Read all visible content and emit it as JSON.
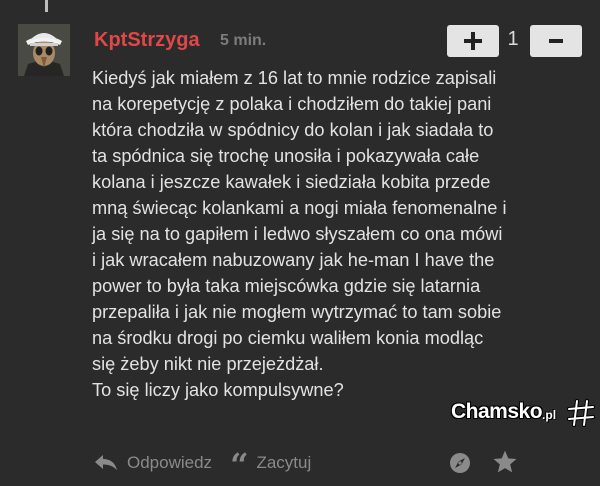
{
  "comment": {
    "author": "KptStrzyga",
    "time": "5 min.",
    "vote_count": "1",
    "text": "Kiedyś jak miałem z 16 lat to mnie rodzice zapisali\nna korepetycję z polaka i chodziłem do takiej pani\nktóra chodziła w spódnicy do kolan i jak siadała to\nta spódnica się trochę unosiła i pokazywała całe\nkolana i jeszcze kawałek i siedziała kobita przede\nmną świecąc kolankami a nogi miała fenomenalne i\nja się na to gapiłem i ledwo słyszałem co ona mówi\ni jak wracałem nabuzowany jak he-man I have the\npower to była taka miejscówka gdzie się latarnia\nprzepaliła i jak nie mogłem wytrzymać to tam sobie\nna środku drogi po ciemku waliłem konia modląc\nsię żeby nikt nie przejeżdżał.\nTo się liczy jako kompulsywne?"
  },
  "actions": {
    "reply_label": "Odpowiedz",
    "quote_label": "Zacytuj"
  },
  "icons": {
    "upvote": "plus-icon",
    "downvote": "minus-icon",
    "reply": "reply-arrow-icon",
    "quote": "quote-icon",
    "compass": "compass-icon",
    "star": "star-icon"
  },
  "watermark": {
    "main": "Chamsko",
    "suffix": ".pl"
  },
  "colors": {
    "background": "#2b2b2b",
    "author": "#e04848",
    "text": "#e2e2e2",
    "muted": "#8a8a8a",
    "vote_button": "#e4e4e4"
  }
}
